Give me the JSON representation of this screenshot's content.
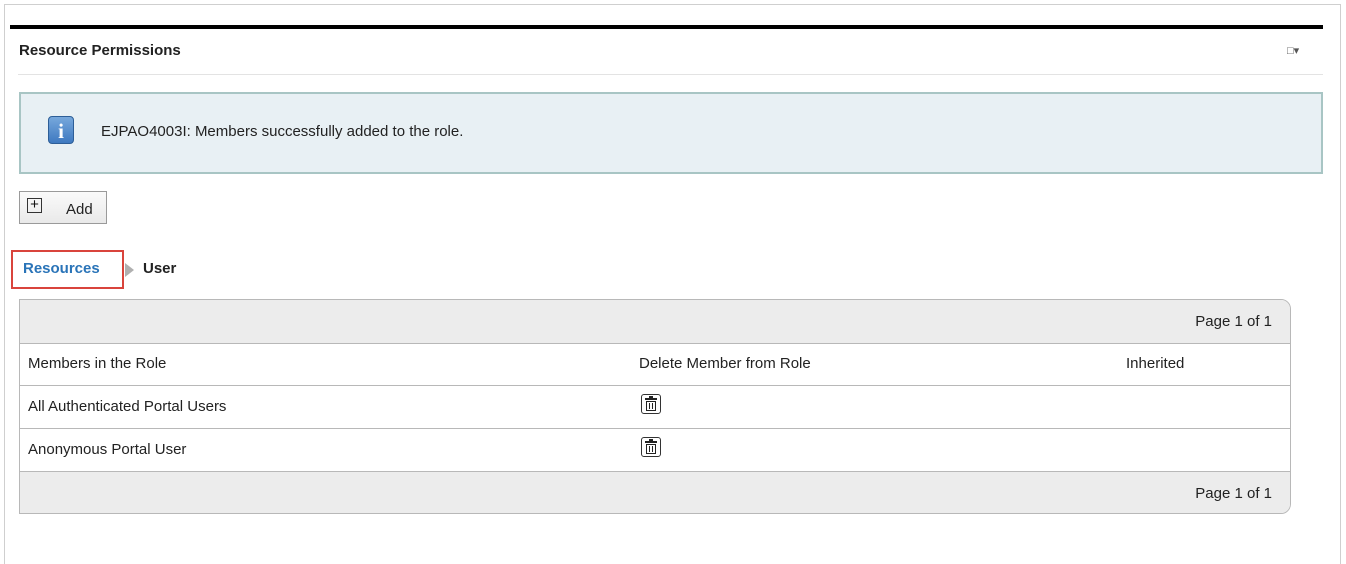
{
  "portlet": {
    "title": "Resource Permissions",
    "menu_icon": "□▾"
  },
  "message": {
    "icon": "info-icon",
    "icon_glyph": "i",
    "text": "EJPAO4003I: Members successfully added to the role."
  },
  "toolbar": {
    "add_icon": "+",
    "add_label": "Add"
  },
  "breadcrumb": {
    "resources": "Resources",
    "current": "User"
  },
  "table": {
    "pager_top": "Page 1 of 1",
    "pager_bottom": "Page 1 of 1",
    "headers": [
      "Members in the Role",
      "Delete Member from Role",
      "Inherited"
    ],
    "rows": [
      {
        "member": "All Authenticated Portal Users",
        "inherited": ""
      },
      {
        "member": "Anonymous Portal User",
        "inherited": ""
      }
    ]
  },
  "colors": {
    "link": "#2a74b8",
    "message_bg": "#e8f0f4",
    "message_border": "#a8c5c4",
    "highlight": "#d9443c"
  }
}
